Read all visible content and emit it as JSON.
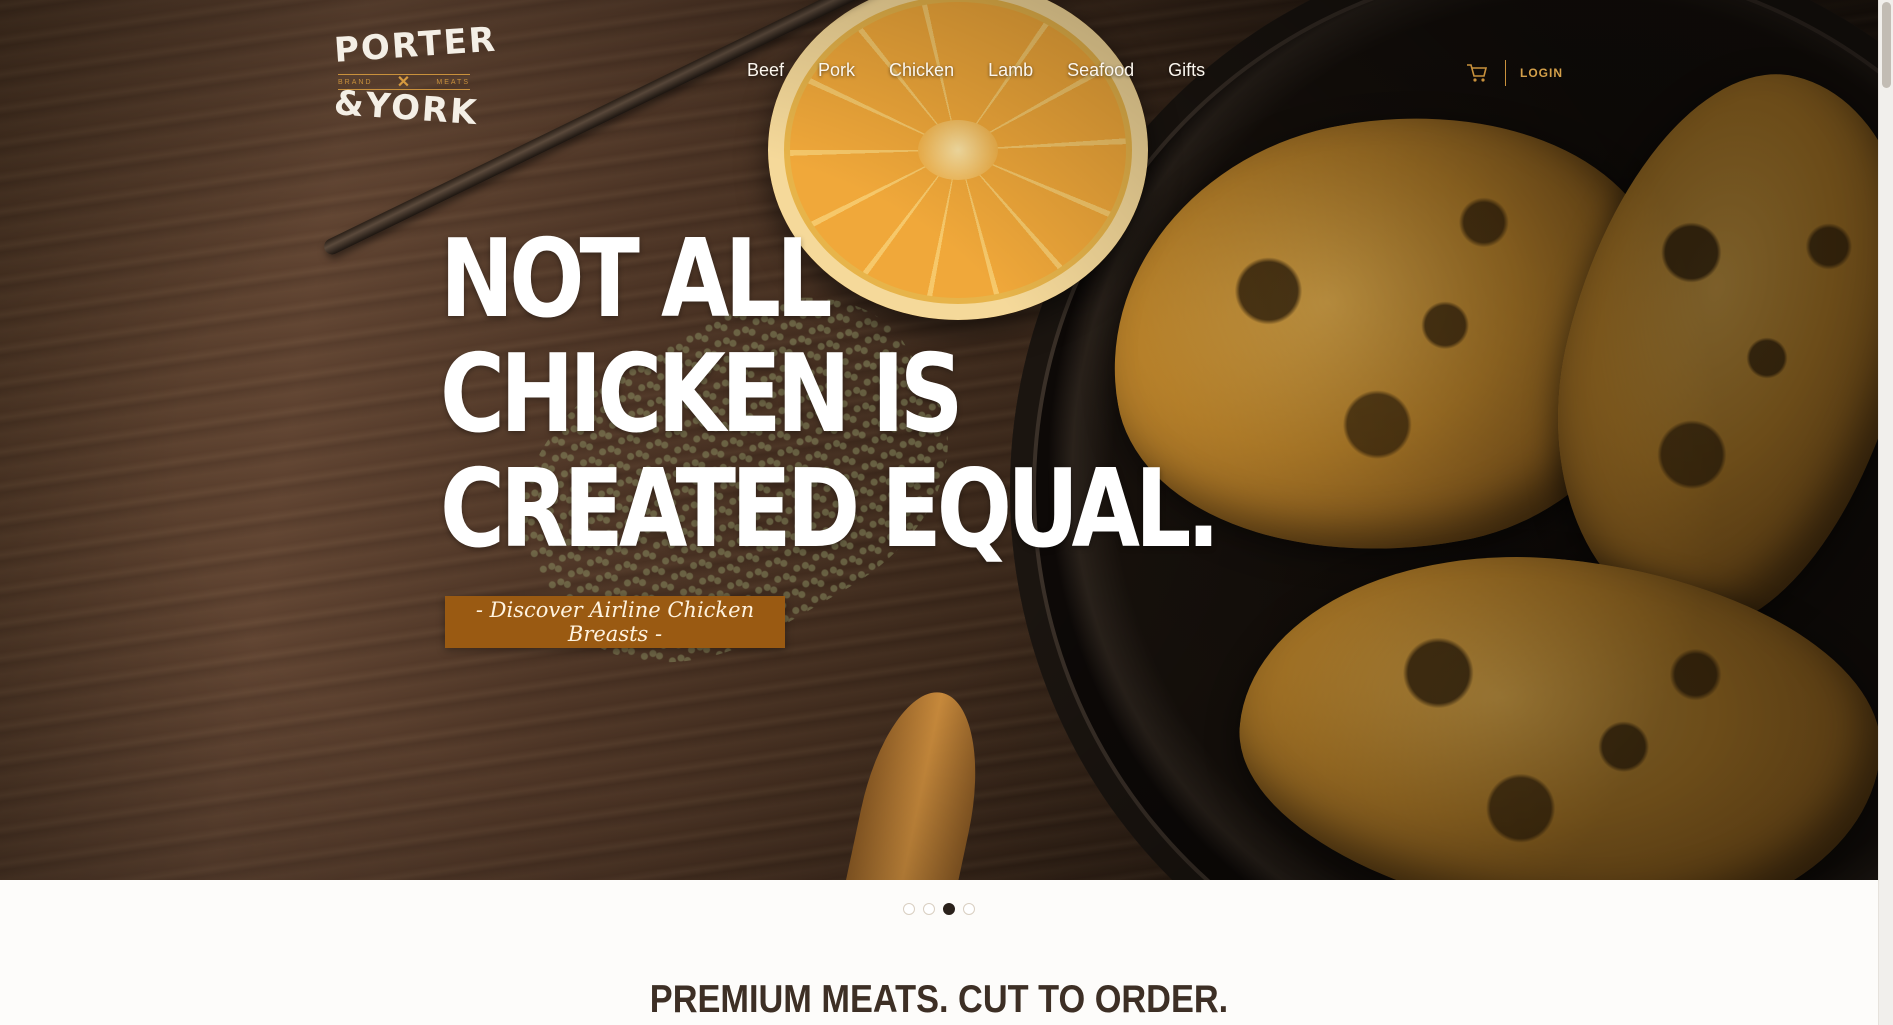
{
  "brand": {
    "logo_top": "PORTER",
    "logo_left": "BRAND",
    "logo_right": "MEATS",
    "logo_bottom": "&YORK"
  },
  "nav": {
    "items": [
      {
        "label": "Beef"
      },
      {
        "label": "Pork"
      },
      {
        "label": "Chicken"
      },
      {
        "label": "Lamb"
      },
      {
        "label": "Seafood"
      },
      {
        "label": "Gifts"
      }
    ],
    "cart_icon": "shopping-cart-icon",
    "login_label": "LOGIN"
  },
  "hero": {
    "headline_lines": [
      "NOT ALL",
      "CHICKEN IS",
      "CREATED EQUAL."
    ],
    "cta_label": "- Discover Airline Chicken Breasts -"
  },
  "carousel": {
    "slide_count": 4,
    "active_index": 2
  },
  "tagline": "PREMIUM MEATS. CUT TO ORDER.",
  "colors": {
    "accent": "#9a5a12",
    "gold": "#c9913c",
    "text_dark": "#3d2f25",
    "background": "#fdfcfa"
  }
}
